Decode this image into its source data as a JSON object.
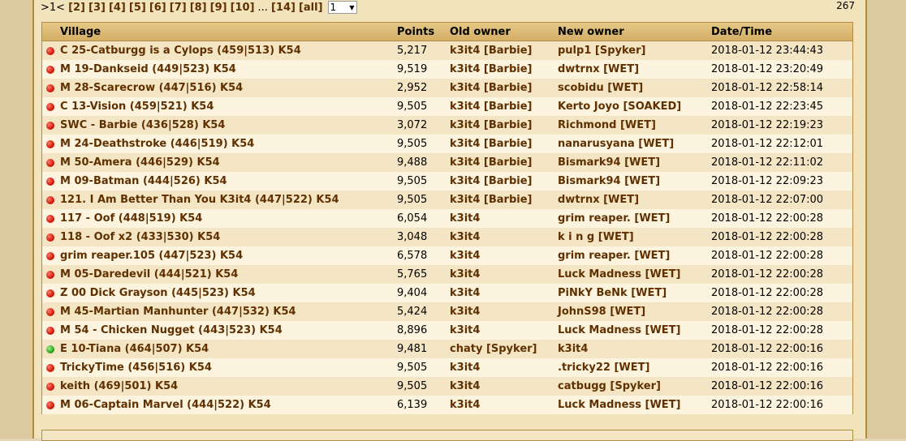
{
  "pager": {
    "current": ">1<",
    "pages": [
      "[2]",
      "[3]",
      "[4]",
      "[5]",
      "[6]",
      "[7]",
      "[8]",
      "[9]",
      "[10]"
    ],
    "ellipsis": "...",
    "last": "[14]",
    "all": "[all]",
    "select_value": "1",
    "count": "267"
  },
  "table": {
    "headers": {
      "village": "Village",
      "points": "Points",
      "old_owner": "Old owner",
      "new_owner": "New owner",
      "datetime": "Date/Time"
    },
    "rows": [
      {
        "dot": "red",
        "village": "C 25-Catburgg is a Cylops (459|513) K54",
        "points": "5,217",
        "old": "k3it4 [Barbie]",
        "new": "pulp1 [Spyker]",
        "date": "2018-01-12 23:44:43"
      },
      {
        "dot": "red",
        "village": "M 19-Dankseid (449|523) K54",
        "points": "9,519",
        "old": "k3it4 [Barbie]",
        "new": "dwtrnx [WET]",
        "date": "2018-01-12 23:20:49"
      },
      {
        "dot": "red",
        "village": "M 28-Scarecrow (447|516) K54",
        "points": "2,952",
        "old": "k3it4 [Barbie]",
        "new": "scobidu [WET]",
        "date": "2018-01-12 22:58:14"
      },
      {
        "dot": "red",
        "village": "C 13-Vision (459|521) K54",
        "points": "9,505",
        "old": "k3it4 [Barbie]",
        "new": "Kerto Joyo [SOAKED]",
        "date": "2018-01-12 22:23:45"
      },
      {
        "dot": "red",
        "village": "SWC - Barbie (436|528) K54",
        "points": "3,072",
        "old": "k3it4 [Barbie]",
        "new": "Richmond [WET]",
        "date": "2018-01-12 22:19:23"
      },
      {
        "dot": "red",
        "village": "M 24-Deathstroke (446|519) K54",
        "points": "9,505",
        "old": "k3it4 [Barbie]",
        "new": "nanarusyana [WET]",
        "date": "2018-01-12 22:12:01"
      },
      {
        "dot": "red",
        "village": "M 50-Amera (446|529) K54",
        "points": "9,488",
        "old": "k3it4 [Barbie]",
        "new": "Bismark94 [WET]",
        "date": "2018-01-12 22:11:02"
      },
      {
        "dot": "red",
        "village": "M 09-Batman (444|526) K54",
        "points": "9,505",
        "old": "k3it4 [Barbie]",
        "new": "Bismark94 [WET]",
        "date": "2018-01-12 22:09:23"
      },
      {
        "dot": "red",
        "village": "121. I Am Better Than You K3it4 (447|522) K54",
        "points": "9,505",
        "old": "k3it4 [Barbie]",
        "new": "dwtrnx [WET]",
        "date": "2018-01-12 22:07:00"
      },
      {
        "dot": "red",
        "village": "117 - Oof (448|519) K54",
        "points": "6,054",
        "old": "k3it4",
        "new": "grim reaper. [WET]",
        "date": "2018-01-12 22:00:28"
      },
      {
        "dot": "red",
        "village": "118 - Oof x2 (433|530) K54",
        "points": "3,048",
        "old": "k3it4",
        "new": "k i n g [WET]",
        "date": "2018-01-12 22:00:28"
      },
      {
        "dot": "red",
        "village": "grim reaper.105 (447|523) K54",
        "points": "6,578",
        "old": "k3it4",
        "new": "grim reaper. [WET]",
        "date": "2018-01-12 22:00:28"
      },
      {
        "dot": "red",
        "village": "M 05-Daredevil (444|521) K54",
        "points": "5,765",
        "old": "k3it4",
        "new": "Luck Madness [WET]",
        "date": "2018-01-12 22:00:28"
      },
      {
        "dot": "red",
        "village": "Z 00 Dick Grayson (445|523) K54",
        "points": "9,404",
        "old": "k3it4",
        "new": "PiNkY BeNk [WET]",
        "date": "2018-01-12 22:00:28"
      },
      {
        "dot": "red",
        "village": "M 45-Martian Manhunter (447|532) K54",
        "points": "5,424",
        "old": "k3it4",
        "new": "JohnS98 [WET]",
        "date": "2018-01-12 22:00:28"
      },
      {
        "dot": "red",
        "village": "M 54 - Chicken Nugget (443|523) K54",
        "points": "8,896",
        "old": "k3it4",
        "new": "Luck Madness [WET]",
        "date": "2018-01-12 22:00:28"
      },
      {
        "dot": "green",
        "village": "E 10-Tiana (464|507) K54",
        "points": "9,481",
        "old": "chaty [Spyker]",
        "new": "k3it4",
        "date": "2018-01-12 22:00:16"
      },
      {
        "dot": "red",
        "village": "TrickyTime (456|516) K54",
        "points": "9,505",
        "old": "k3it4",
        "new": ".tricky22 [WET]",
        "date": "2018-01-12 22:00:16"
      },
      {
        "dot": "red",
        "village": "keith (469|501) K54",
        "points": "9,505",
        "old": "k3it4",
        "new": "catbugg [Spyker]",
        "date": "2018-01-12 22:00:16"
      },
      {
        "dot": "red",
        "village": "M 06-Captain Marvel (444|522) K54",
        "points": "6,139",
        "old": "k3it4",
        "new": "Luck Madness [WET]",
        "date": "2018-01-12 22:00:16"
      }
    ]
  },
  "colors": {
    "link": "#603000",
    "header_bg": "#d9b873",
    "row_odd": "#f4e6c4",
    "row_even": "#fcf4de",
    "dot_red": "#d21a0a",
    "dot_green": "#2fa51e"
  }
}
